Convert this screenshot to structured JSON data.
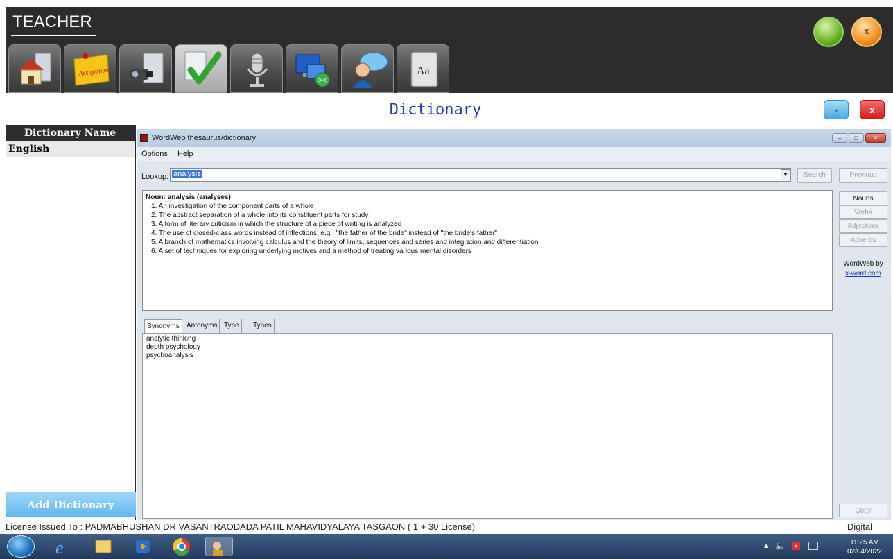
{
  "app": {
    "title": "TEACHER",
    "minimize_label": "",
    "close_label": "x",
    "nav_tiles": [
      {
        "icon": "home-icon"
      },
      {
        "icon": "assignment-icon",
        "label": "Assignment"
      },
      {
        "icon": "camera-icon"
      },
      {
        "icon": "check-icon"
      },
      {
        "icon": "microphone-icon"
      },
      {
        "icon": "remote-desktop-icon"
      },
      {
        "icon": "chat-user-icon"
      },
      {
        "icon": "dictionary-book-icon",
        "label": "Aa"
      }
    ]
  },
  "dictionary_panel": {
    "title": "Dictionary",
    "minimize_label": "-",
    "close_label": "x",
    "list_header": "Dictionary Name",
    "list_items": [
      "English"
    ],
    "add_button": "Add Dictionary"
  },
  "wordweb": {
    "title": "WordWeb thesaurus/dictionary",
    "menu": [
      "Options",
      "Help"
    ],
    "lookup_label": "Lookup:",
    "lookup_value": "analysis",
    "search_label": "Search",
    "previous_label": "Previous",
    "part_of_speech": [
      "Nouns",
      "Verbs",
      "Adjectives",
      "Adverbs"
    ],
    "copy_label": "Copy",
    "credit_text": "WordWeb by",
    "credit_link": "x-word.com",
    "definition_heading": "Noun: analysis (analyses)",
    "definitions": [
      "1. An investigation of the component parts of a whole",
      "2. The abstract separation of a whole into its constituent parts for study",
      "3. A form of literary criticism in which the structure of a piece of writing is analyzed",
      "4. The use of closed-class words instead of inflections: e.g., \"the father of the bride\" instead of \"the bride's father\"",
      "5. A branch of mathematics involving calculus and the theory of limits; sequences and series and integration and differentiation",
      "6. A set of techniques for exploring underlying motives and a method of treating various mental disorders"
    ],
    "tabs": [
      "Synonyms",
      "Antonyms",
      "Type of",
      "Types"
    ],
    "synonyms": [
      "analytic thinking",
      "depth psychology",
      "psychoanalysis"
    ]
  },
  "footer": {
    "license": "License Issued To :   PADMABHUSHAN DR VASANTRAODADA PATIL MAHAVIDYALAYA TASGAON ( 1 + 30 License)",
    "right": "Digital"
  },
  "taskbar": {
    "time": "11:25 AM",
    "date": "02/04/2022"
  }
}
